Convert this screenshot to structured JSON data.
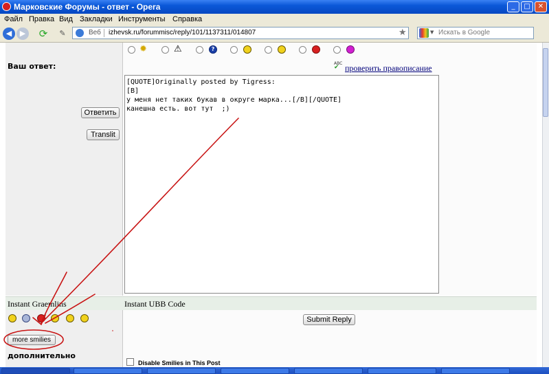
{
  "window": {
    "title": "Марковские Форумы - ответ - Opera",
    "controls": {
      "minimize": "_",
      "maximize": "□",
      "close": "✕"
    }
  },
  "menu": [
    "Файл",
    "Правка",
    "Вид",
    "Закладки",
    "Инструменты",
    "Справка"
  ],
  "toolbar": {
    "address_label": "Веб",
    "url": "izhevsk.ru/forummisc/reply/101/1137311/014807",
    "search_placeholder": "Искать в Google",
    "icons": [
      "back-icon",
      "forward-icon",
      "reload-icon",
      "edit-icon",
      "globe-icon",
      "star-icon",
      "google-icon"
    ]
  },
  "form": {
    "answer_label": "Ваш ответ:",
    "spellcheck_label": "проверить правописание",
    "spellcheck_icon_text": "ABC",
    "buttons": {
      "reply": "Ответить",
      "translit": "Translit",
      "submit": "Submit Reply",
      "more_smilies": "more smilies"
    },
    "message_lines": [
      "[QUOTE]Originally posted by Tigress:",
      "[B]",
      "у меня нет таких букав в округе марка...[/B][/QUOTE]",
      "",
      "канешна есть. вот тут  ;)"
    ],
    "instant_graemlins_label": "Instant Graemlins",
    "instant_ubb_label": "Instant UBB Code",
    "extra_label": "дополнительно",
    "disable_smilies_label": "Disable Smilies in This Post",
    "post_icons": [
      "lightbulb-icon",
      "warning-icon",
      "question-icon",
      "cool-icon",
      "smile-icon",
      "angry-icon",
      "purple-icon"
    ],
    "graemlins": [
      "smile",
      "sad",
      "angry",
      "wink",
      "grin",
      "laugh"
    ]
  },
  "colors": {
    "titlebar": "#0a58d8",
    "annotation": "#c81414",
    "link": "#00007a",
    "instant_bar": "#e7efe7"
  }
}
